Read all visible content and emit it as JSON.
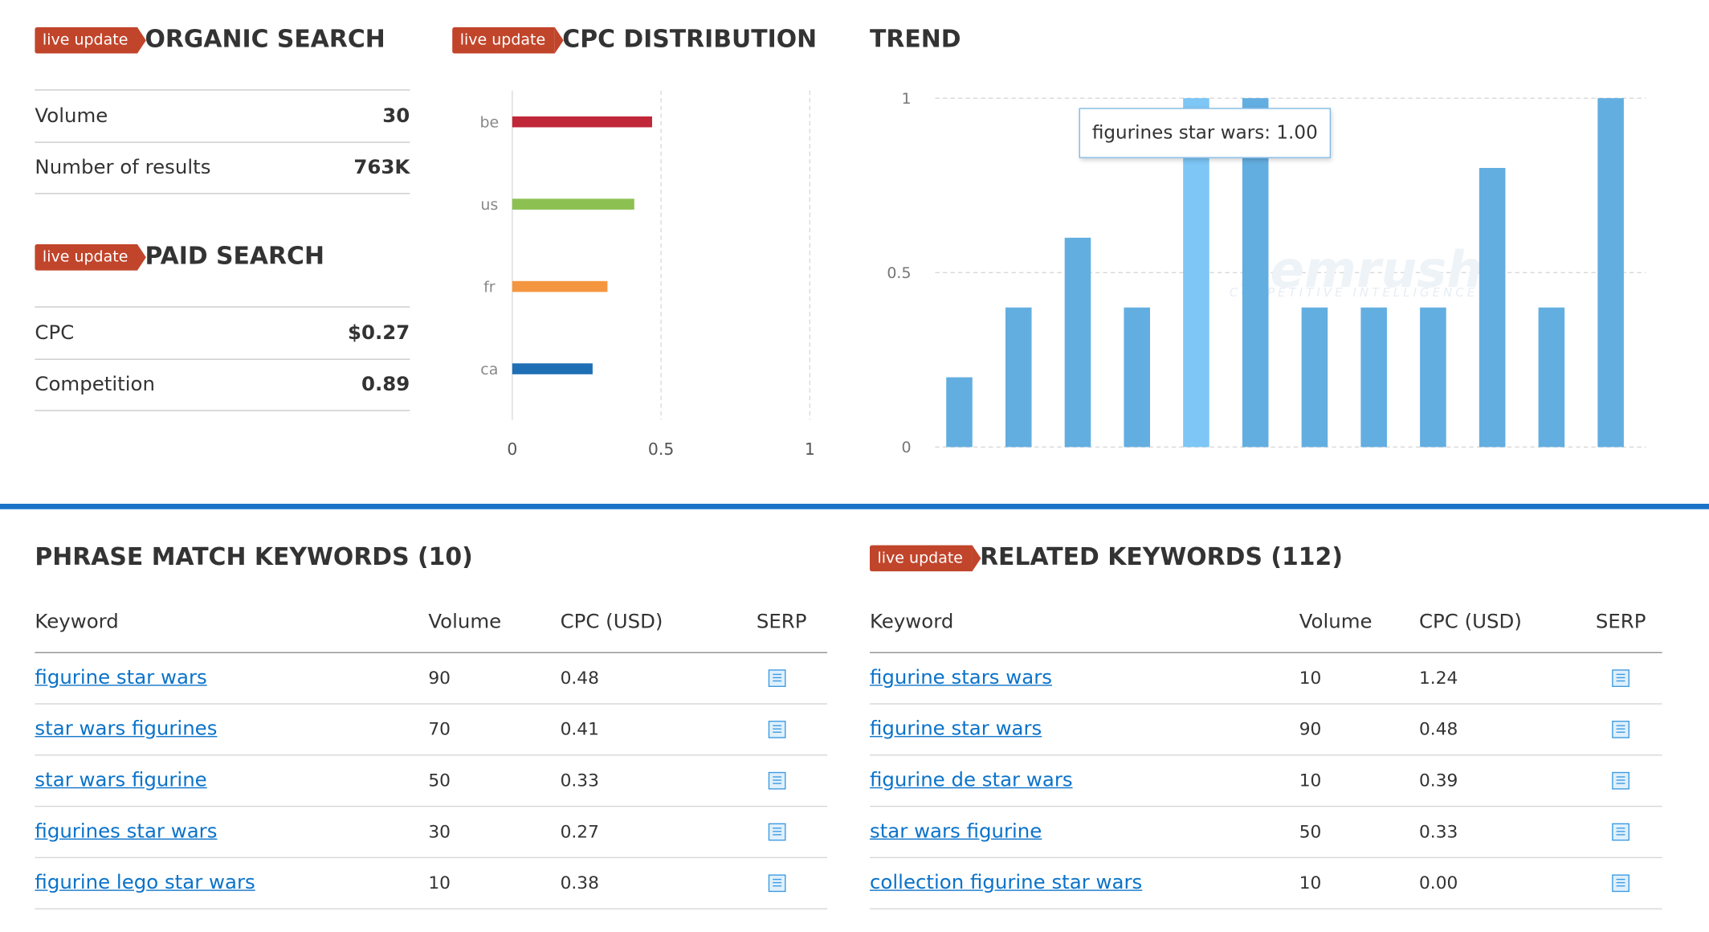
{
  "badge_text": "live update",
  "organic": {
    "title": "ORGANIC SEARCH",
    "rows": [
      {
        "label": "Volume",
        "value": "30"
      },
      {
        "label": "Number of results",
        "value": "763K"
      }
    ]
  },
  "paid": {
    "title": "PAID SEARCH",
    "rows": [
      {
        "label": "CPC",
        "value": "$0.27"
      },
      {
        "label": "Competition",
        "value": "0.89"
      }
    ]
  },
  "cpc_distribution": {
    "title": "CPC DISTRIBUTION",
    "chart_data": {
      "type": "bar",
      "orientation": "horizontal",
      "categories": [
        "be",
        "us",
        "fr",
        "ca"
      ],
      "values": [
        0.47,
        0.41,
        0.32,
        0.27
      ],
      "colors": [
        "#c0283a",
        "#8cc152",
        "#f4963f",
        "#1f6fb5"
      ],
      "xlim": [
        0,
        1
      ],
      "xticks": [
        "0",
        "0.5",
        "1"
      ],
      "grid": true
    }
  },
  "trend": {
    "title": "TREND",
    "tooltip": {
      "label": "figurines star wars:",
      "value": "1.00"
    },
    "watermark": "semrush",
    "watermark_sub": "COMPETITIVE INTELLIGENCE",
    "chart_data": {
      "type": "bar",
      "values": [
        0.2,
        0.4,
        0.6,
        0.4,
        1.0,
        1.0,
        0.4,
        0.4,
        0.4,
        0.8,
        0.4,
        1.0
      ],
      "ylim": [
        0,
        1
      ],
      "yticks": [
        "0",
        "0.5",
        "1"
      ],
      "highlight_index": 4,
      "bar_color": "#63aee0",
      "highlight_color": "#7dc6f5",
      "grid": true
    }
  },
  "phrase_match": {
    "title": "PHRASE MATCH KEYWORDS (10)",
    "headers": [
      "Keyword",
      "Volume",
      "CPC (USD)",
      "SERP"
    ],
    "rows": [
      {
        "keyword": "figurine star wars",
        "volume": "90",
        "cpc": "0.48"
      },
      {
        "keyword": "star wars figurines",
        "volume": "70",
        "cpc": "0.41"
      },
      {
        "keyword": "star wars figurine",
        "volume": "50",
        "cpc": "0.33"
      },
      {
        "keyword": "figurines star wars",
        "volume": "30",
        "cpc": "0.27"
      },
      {
        "keyword": "figurine lego star wars",
        "volume": "10",
        "cpc": "0.38"
      }
    ]
  },
  "related": {
    "title": "RELATED KEYWORDS (112)",
    "headers": [
      "Keyword",
      "Volume",
      "CPC (USD)",
      "SERP"
    ],
    "rows": [
      {
        "keyword": "figurine stars wars",
        "volume": "10",
        "cpc": "1.24"
      },
      {
        "keyword": "figurine star wars",
        "volume": "90",
        "cpc": "0.48"
      },
      {
        "keyword": "figurine de star wars",
        "volume": "10",
        "cpc": "0.39"
      },
      {
        "keyword": "star wars figurine",
        "volume": "50",
        "cpc": "0.33"
      },
      {
        "keyword": "collection figurine star wars",
        "volume": "10",
        "cpc": "0.00"
      }
    ]
  },
  "colors": {
    "accent_badge": "#c1452b",
    "divider": "#1a73c8",
    "link": "#0a72c9"
  }
}
